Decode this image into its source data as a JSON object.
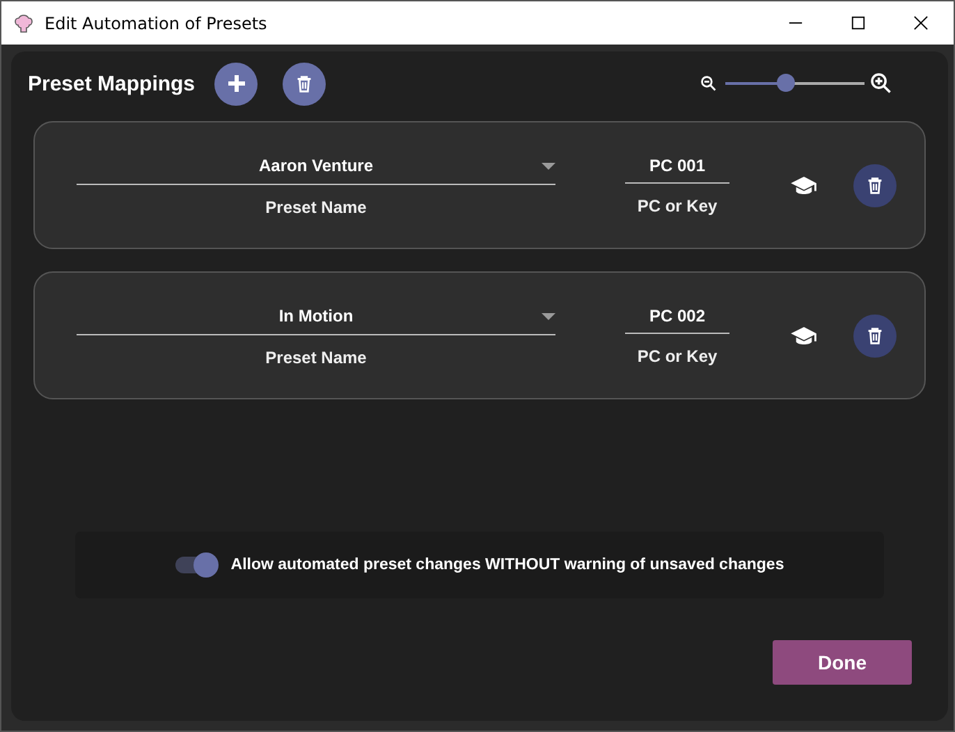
{
  "window": {
    "title": "Edit Automation of Presets"
  },
  "header": {
    "title": "Preset Mappings"
  },
  "zoom": {
    "level": 0.44
  },
  "mappings": [
    {
      "preset": "Aaron Venture",
      "preset_label": "Preset Name",
      "pc": "PC 001",
      "pc_label": "PC or Key"
    },
    {
      "preset": "In Motion",
      "preset_label": "Preset Name",
      "pc": "PC 002",
      "pc_label": "PC or Key"
    }
  ],
  "option": {
    "label": "Allow automated preset changes WITHOUT warning of unsaved changes",
    "on": true
  },
  "buttons": {
    "done": "Done"
  }
}
